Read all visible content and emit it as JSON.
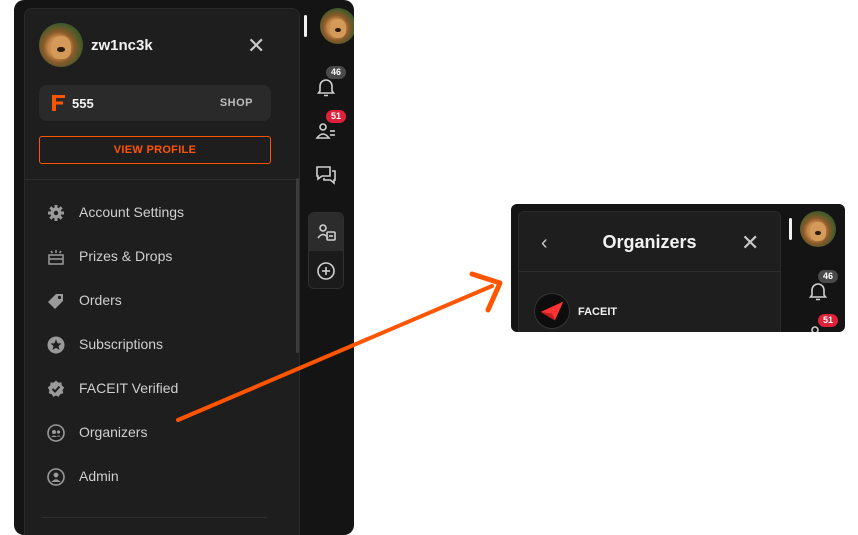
{
  "profile_panel": {
    "username": "zw1nc3k",
    "points": "555",
    "shop_label": "SHOP",
    "view_profile_label": "VIEW PROFILE",
    "menu": [
      {
        "label": "Account Settings",
        "icon": "gear-icon"
      },
      {
        "label": "Prizes & Drops",
        "icon": "gift-icon"
      },
      {
        "label": "Orders",
        "icon": "tag-icon"
      },
      {
        "label": "Subscriptions",
        "icon": "star-icon"
      },
      {
        "label": "FACEIT Verified",
        "icon": "verified-icon"
      },
      {
        "label": "Organizers",
        "icon": "organizers-icon"
      },
      {
        "label": "Admin",
        "icon": "admin-icon"
      }
    ]
  },
  "rail": {
    "notifications_count": "46",
    "friends_count": "51"
  },
  "organizers_panel": {
    "title": "Organizers",
    "items": [
      {
        "name": "FACEIT"
      }
    ]
  },
  "colors": {
    "accent": "#ff5500",
    "badge_red": "#e0213a",
    "badge_grey": "#4a4a4a",
    "panel_bg": "#1e1e1e",
    "app_bg": "#141414"
  }
}
